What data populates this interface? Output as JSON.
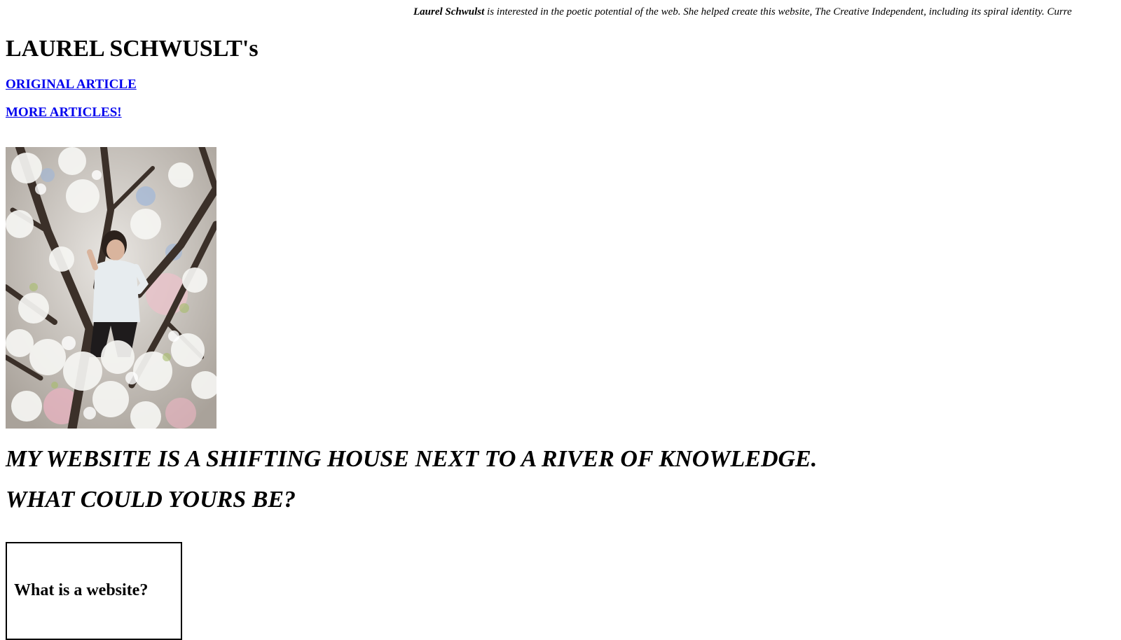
{
  "bio": {
    "name": "Laurel Schwulst",
    "text": "is interested in the poetic potential of the web. She helped create this website, The Creative Independent, including its spiral identity. Curre"
  },
  "page_title": "LAUREL SCHWUSLT's",
  "nav": {
    "original_article": "ORIGINAL ARTICLE",
    "more_articles": "MORE ARTICLES!"
  },
  "photo": {
    "alt": "Person standing in a flowering tree"
  },
  "headlines": {
    "line1": "MY WEBSITE IS A SHIFTING HOUSE NEXT TO A RIVER OF KNOWLEDGE.",
    "line2": "WHAT COULD YOURS BE?"
  },
  "question_box": {
    "title": "What is a website?"
  },
  "colors": {
    "link": "#0000ee",
    "text": "#000000",
    "background": "#ffffff"
  }
}
